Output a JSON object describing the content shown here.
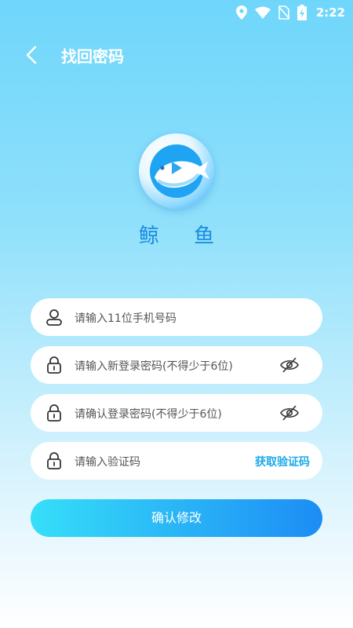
{
  "status": {
    "time": "2:22"
  },
  "header": {
    "title": "找回密码"
  },
  "brand": {
    "name": "鲸 鱼"
  },
  "form": {
    "phone_placeholder": "请输入11位手机号码",
    "new_password_placeholder": "请输入新登录密码(不得少于6位)",
    "confirm_password_placeholder": "请确认登录密码(不得少于6位)",
    "code_placeholder": "请输入验证码",
    "get_code_label": "获取验证码",
    "submit_label": "确认修改"
  },
  "colors": {
    "accent": "#1aa9e8",
    "brand": "#1a8de0"
  }
}
